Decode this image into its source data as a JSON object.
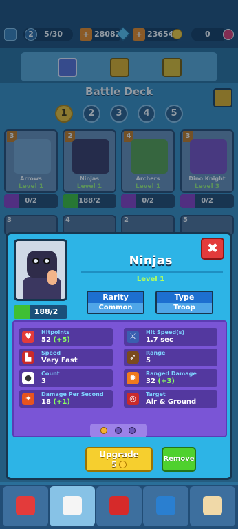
{
  "topbar": {
    "level": "2",
    "xp": "5/30",
    "gems": "28082",
    "coins": "23654",
    "trophies": "0"
  },
  "deck": {
    "title": "Battle Deck",
    "slots": [
      "1",
      "2",
      "3",
      "4",
      "5"
    ],
    "active_slot": "1"
  },
  "cards": [
    {
      "level_num": "3",
      "name": "Arrows",
      "level": "Level 1",
      "progress": "0/2"
    },
    {
      "level_num": "2",
      "name": "Ninjas",
      "level": "Level 1",
      "progress": "188/2"
    },
    {
      "level_num": "4",
      "name": "Archers",
      "level": "Level 1",
      "progress": "0/2"
    },
    {
      "level_num": "3",
      "name": "Dino Knight",
      "level": "Level 3",
      "progress": "0/2"
    }
  ],
  "row2_levels": [
    "3",
    "4",
    "2",
    "5"
  ],
  "modal": {
    "close": "✖",
    "name": "Ninjas",
    "level": "Level 1",
    "cards_progress": "188/2",
    "rarity_label": "Rarity",
    "rarity_value": "Common",
    "type_label": "Type",
    "type_value": "Troop",
    "stats": {
      "hitpoints": {
        "label": "Hitpoints",
        "value": "52",
        "bonus": "(+5)"
      },
      "hit_speed": {
        "label": "Hit Speed(s)",
        "value": "1.7 sec"
      },
      "speed": {
        "label": "Speed",
        "value": "Very Fast"
      },
      "range": {
        "label": "Range",
        "value": "5"
      },
      "count": {
        "label": "Count",
        "value": "3"
      },
      "ranged_damage": {
        "label": "Ranged Damage",
        "value": "32",
        "bonus": "(+3)"
      },
      "dps": {
        "label": "Damage Per Second",
        "value": "18",
        "bonus": "(+1)"
      },
      "target": {
        "label": "Target",
        "value": "Air & Ground"
      }
    },
    "upgrade_label": "Upgrade",
    "upgrade_cost": "5",
    "remove_label": "Remove"
  },
  "colors": {
    "modal_bg": "#2db4e6",
    "stats_panel": "#7a55d6",
    "upgrade": "#f6cf2e",
    "remove": "#4fd12e",
    "close": "#e33b3b"
  }
}
